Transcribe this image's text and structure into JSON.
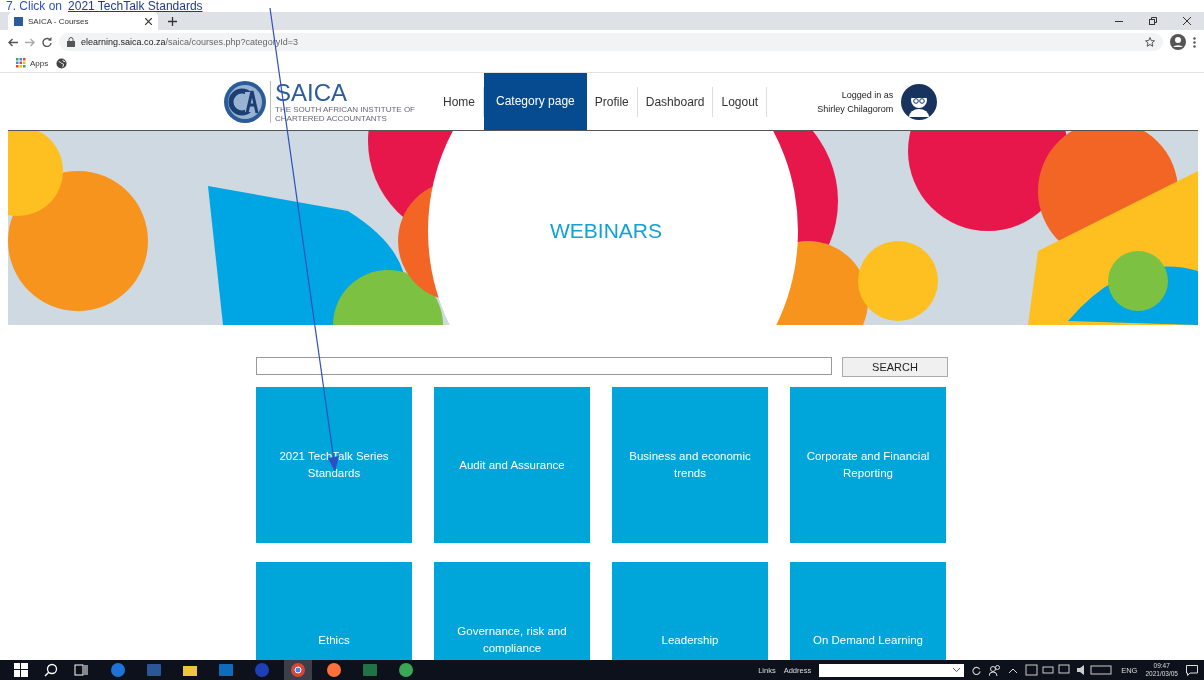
{
  "annotation": {
    "step": "7. Click on",
    "link": "2021 TechTalk Standards"
  },
  "browser": {
    "tab_title": "SAICA - Courses",
    "url_host": "elearning.saica.co.za",
    "url_path": "/saica/courses.php?categoryId=3",
    "bookmarks": [
      "Apps"
    ]
  },
  "site": {
    "logo": {
      "name": "SAICA",
      "tagline": "THE SOUTH AFRICAN INSTITUTE OF CHARTERED ACCOUNTANTS"
    },
    "nav": [
      {
        "label": "Home",
        "selected": false
      },
      {
        "label": "Category page",
        "selected": true
      },
      {
        "label": "Profile",
        "selected": false
      },
      {
        "label": "Dashboard",
        "selected": false
      },
      {
        "label": "Logout",
        "selected": false
      }
    ],
    "user": {
      "label": "Logged in as",
      "name": "Shirley Chilagorom"
    }
  },
  "banner": {
    "title": "WEBINARS"
  },
  "search": {
    "button": "SEARCH"
  },
  "categories": [
    "2021 TechTalk Series Standards",
    "Audit and Assurance",
    "Business and economic trends",
    "Corporate and Financial Reporting",
    "Ethics",
    "Governance, risk and compliance",
    "Leadership",
    "On Demand Learning"
  ],
  "taskbar": {
    "apps": [
      {
        "kind": "edge",
        "selected": false
      },
      {
        "kind": "word",
        "selected": false
      },
      {
        "kind": "folder",
        "selected": false
      },
      {
        "kind": "outlook",
        "selected": false
      },
      {
        "kind": "info",
        "selected": false
      },
      {
        "kind": "chrome",
        "selected": true
      },
      {
        "kind": "firefox",
        "selected": false
      },
      {
        "kind": "excel",
        "selected": false
      },
      {
        "kind": "globe",
        "selected": false
      }
    ],
    "links": "Links",
    "address": "Address",
    "language": "ENG",
    "time": "09:47",
    "date": "2021/03/05"
  }
}
